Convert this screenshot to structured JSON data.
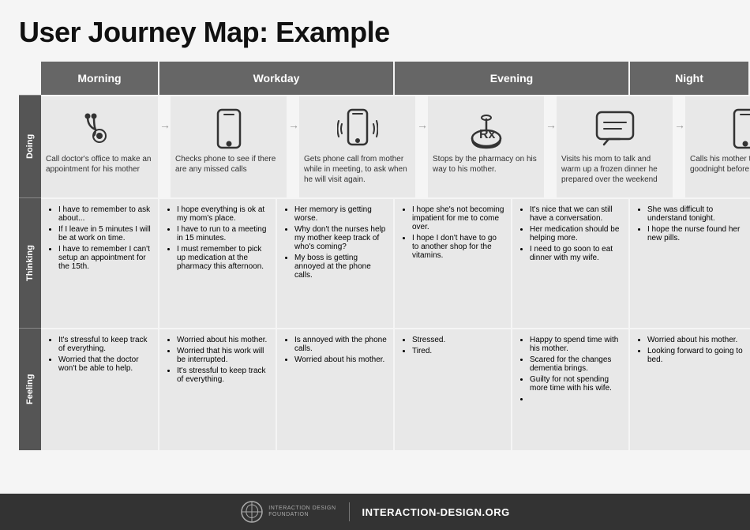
{
  "title": "User Journey Map: Example",
  "phases": {
    "morning": "Morning",
    "workday": "Workday",
    "evening": "Evening",
    "night": "Night"
  },
  "row_labels": {
    "doing": "Doing",
    "thinking": "Thinking",
    "feeling": "Feeling"
  },
  "doing": {
    "morning": {
      "icon": "stethoscope",
      "text": "Call doctor's office to make an appointment for his mother"
    },
    "workday1": {
      "icon": "phone",
      "text": "Checks phone to see if there are any missed calls"
    },
    "workday2": {
      "icon": "phone-ring",
      "text": "Gets phone call from mother while in meeting, to ask when he will visit again."
    },
    "evening1": {
      "icon": "prescription",
      "text": "Stops by the pharmacy on his way to his mother."
    },
    "evening2": {
      "icon": "chat",
      "text": "Visits his mom to talk and warm up a frozen dinner he prepared over the weekend"
    },
    "night": {
      "icon": "phone2",
      "text": "Calls his mother to say goodnight before going to bed."
    }
  },
  "thinking": {
    "morning": [
      "I have to remember to ask about...",
      "If I leave in 5 minutes I will be at work on time.",
      "I have to remember I can't setup an appointment for the 15th."
    ],
    "workday1": [
      "I hope everything is ok at my mom's place.",
      "I have to run to a meeting in 15 minutes.",
      "I must remember to pick up medication at the pharmacy this afternoon."
    ],
    "workday2": [
      "Her memory is getting worse.",
      "Why don't the nurses help my mother keep track of who's coming?",
      "My boss is getting annoyed at the phone calls."
    ],
    "evening1": [
      "I hope she's not becoming impatient for me to come over.",
      "I hope I don't have to go to another shop for the vitamins."
    ],
    "evening2": [
      "It's nice that we can still have a conversation.",
      "Her medication should be helping more.",
      "I need to go soon to eat dinner with my wife."
    ],
    "night": [
      "She was difficult to understand tonight.",
      "I hope the nurse found her new pills."
    ]
  },
  "feeling": {
    "morning": [
      "It's stressful to keep track of everything.",
      "Worried that the doctor won't be able to help."
    ],
    "workday1": [
      "Worried about his mother.",
      "Worried that his work will be interrupted.",
      "It's stressful to keep track of everything."
    ],
    "workday2": [
      "Is annoyed with the phone calls.",
      "Worried about his mother."
    ],
    "evening1": [
      "Stressed.",
      "Tired."
    ],
    "evening2": [
      "Happy to spend time with his mother.",
      "Scared for the changes dementia brings.",
      "Guilty for not spending more time with his wife."
    ],
    "night": [
      "Worried about his mother.",
      "Looking forward to going to bed."
    ]
  },
  "footer": {
    "org_name": "INTERACTION DESIGN FOUNDATION",
    "url": "INTERACTION-DESIGN.ORG"
  }
}
